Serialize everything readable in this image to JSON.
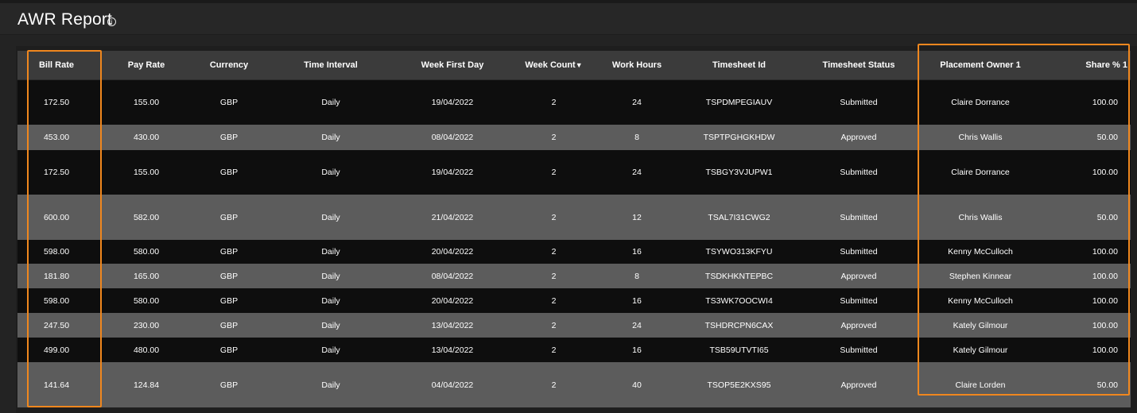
{
  "title": "AWR Report",
  "info_icon_glyph": "i",
  "sort_indicator": "▼",
  "highlight_color": "#f0871e",
  "columns": [
    "Bill Rate",
    "Pay Rate",
    "Currency",
    "Time Interval",
    "Week First Day",
    "Week Count",
    "Work Hours",
    "Timesheet Id",
    "Timesheet Status",
    "Placement Owner 1",
    "Share % 1"
  ],
  "rows": [
    [
      "172.50",
      "155.00",
      "GBP",
      "Daily",
      "19/04/2022",
      "2",
      "24",
      "TSPDMPEGIAUV",
      "Submitted",
      "Claire Dorrance",
      "100.00"
    ],
    [
      "453.00",
      "430.00",
      "GBP",
      "Daily",
      "08/04/2022",
      "2",
      "8",
      "TSPTPGHGKHDW",
      "Approved",
      "Chris Wallis",
      "50.00"
    ],
    [
      "172.50",
      "155.00",
      "GBP",
      "Daily",
      "19/04/2022",
      "2",
      "24",
      "TSBGY3VJUPW1",
      "Submitted",
      "Claire Dorrance",
      "100.00"
    ],
    [
      "600.00",
      "582.00",
      "GBP",
      "Daily",
      "21/04/2022",
      "2",
      "12",
      "TSAL7I31CWG2",
      "Submitted",
      "Chris Wallis",
      "50.00"
    ],
    [
      "598.00",
      "580.00",
      "GBP",
      "Daily",
      "20/04/2022",
      "2",
      "16",
      "TSYWO313KFYU",
      "Submitted",
      "Kenny McCulloch",
      "100.00"
    ],
    [
      "181.80",
      "165.00",
      "GBP",
      "Daily",
      "08/04/2022",
      "2",
      "8",
      "TSDKHKNTEPBC",
      "Approved",
      "Stephen Kinnear",
      "100.00"
    ],
    [
      "598.00",
      "580.00",
      "GBP",
      "Daily",
      "20/04/2022",
      "2",
      "16",
      "TS3WK7OOCWI4",
      "Submitted",
      "Kenny McCulloch",
      "100.00"
    ],
    [
      "247.50",
      "230.00",
      "GBP",
      "Daily",
      "13/04/2022",
      "2",
      "24",
      "TSHDRCPN6CAX",
      "Approved",
      "Kately Gilmour",
      "100.00"
    ],
    [
      "499.00",
      "480.00",
      "GBP",
      "Daily",
      "13/04/2022",
      "2",
      "16",
      "TSB59UTVTI65",
      "Submitted",
      "Kately Gilmour",
      "100.00"
    ],
    [
      "141.64",
      "124.84",
      "GBP",
      "Daily",
      "04/04/2022",
      "2",
      "40",
      "TSOP5E2KXS95",
      "Approved",
      "Claire Lorden",
      "50.00"
    ]
  ]
}
